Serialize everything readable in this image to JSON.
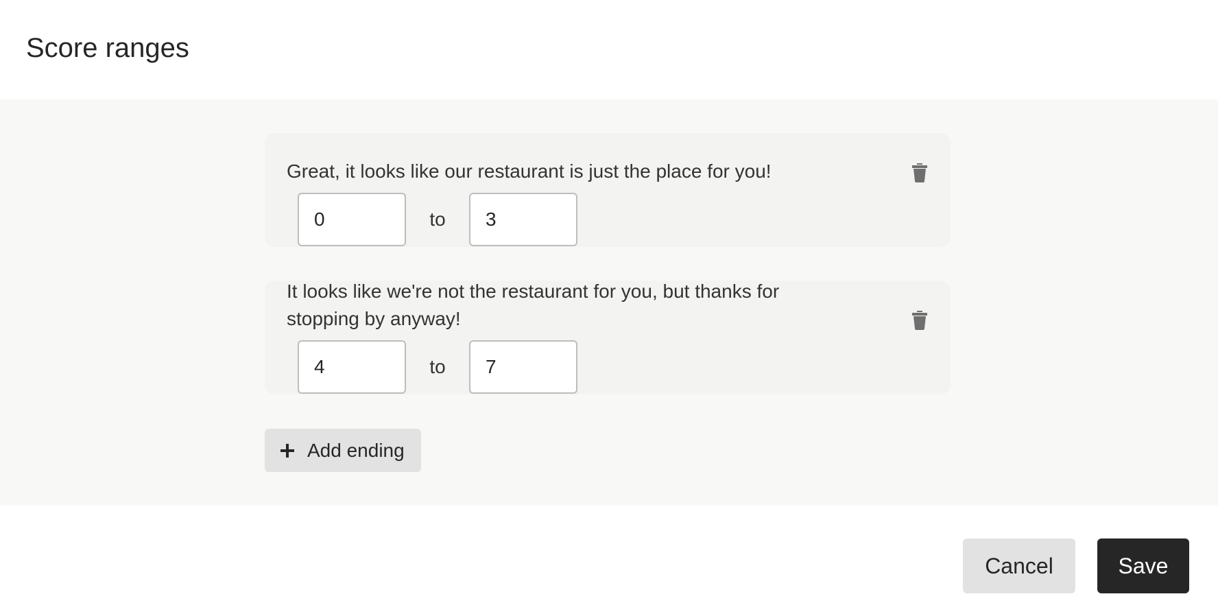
{
  "dialog": {
    "title": "Score ranges"
  },
  "endings": [
    {
      "message": "Great, it looks like our restaurant is just the place for you!",
      "min": "0",
      "max": "3",
      "separator": "to",
      "delete_icon": "trash-icon"
    },
    {
      "message": "It looks like we're not the restaurant for you, but thanks for stopping by anyway!",
      "min": "4",
      "max": "7",
      "separator": "to",
      "delete_icon": "trash-icon"
    }
  ],
  "add_ending": {
    "label": "Add ending",
    "icon": "plus-icon"
  },
  "footer": {
    "cancel_label": "Cancel",
    "save_label": "Save"
  },
  "colors": {
    "panel_background": "#f8f8f7",
    "card_background": "#f3f3f1",
    "primary_button": "#262626",
    "secondary_button": "#e2e2e2",
    "icon": "#6f6f6f"
  }
}
